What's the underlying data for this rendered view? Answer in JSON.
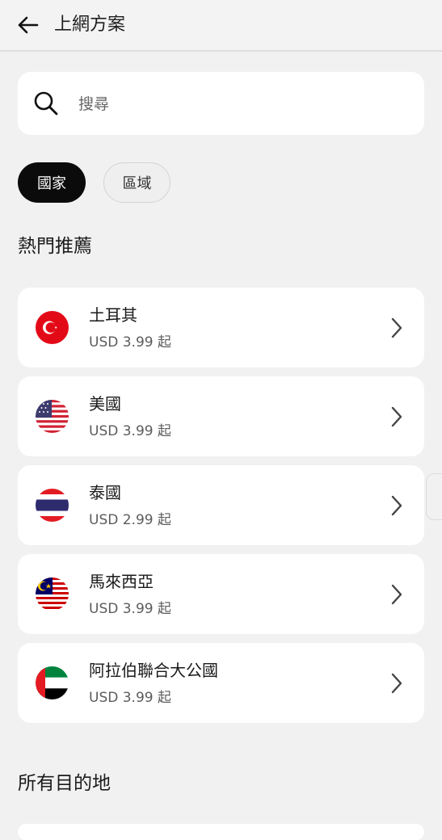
{
  "header": {
    "title": "上網方案"
  },
  "search": {
    "placeholder": "搜尋"
  },
  "filters": {
    "country_label": "國家",
    "region_label": "區域"
  },
  "sections": {
    "popular_title": "熱門推薦",
    "all_title": "所有目的地"
  },
  "popular": [
    {
      "name": "土耳其",
      "price": "USD 3.99 起",
      "flag": "turkey-flag"
    },
    {
      "name": "美國",
      "price": "USD 3.99 起",
      "flag": "usa-flag"
    },
    {
      "name": "泰國",
      "price": "USD 2.99 起",
      "flag": "thailand-flag"
    },
    {
      "name": "馬來西亞",
      "price": "USD 3.99 起",
      "flag": "malaysia-flag"
    },
    {
      "name": "阿拉伯聯合大公國",
      "price": "USD 3.99 起",
      "flag": "uae-flag"
    }
  ],
  "colors": {
    "background": "#f1f1f1",
    "card": "#ffffff",
    "chip_active": "#0b0b0b"
  }
}
